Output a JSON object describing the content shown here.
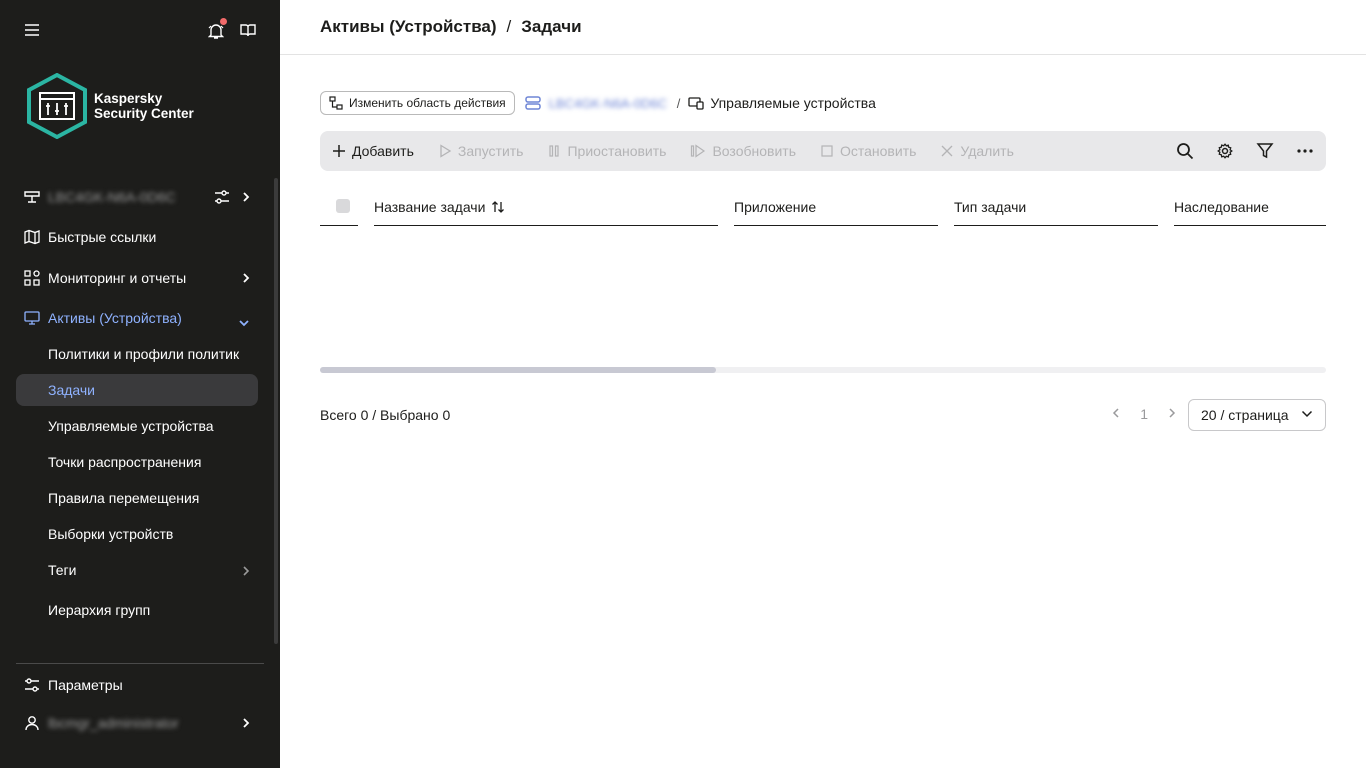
{
  "sidebar": {
    "logo_line1": "Kaspersky",
    "logo_line2": "Security Center",
    "server_name": "LBC4GK-N6A-0D6C",
    "quick_links": "Быстрые ссылки",
    "monitoring": "Мониторинг и отчеты",
    "assets": "Активы (Устройства)",
    "sub_items": [
      "Политики и профили политик",
      "Задачи",
      "Управляемые устройства",
      "Точки распространения",
      "Правила перемещения",
      "Выборки устройств",
      "Теги",
      "Иерархия групп"
    ],
    "settings": "Параметры",
    "user": "lbcmgr_administrator"
  },
  "header": {
    "crumb1": "Активы (Устройства)",
    "sep": "/",
    "crumb2": "Задачи"
  },
  "scope": {
    "change_button": "Изменить область действия",
    "server": "LBC4GK-N6A-0D6C",
    "sep": "/",
    "group": "Управляемые устройства"
  },
  "toolbar": {
    "add": "Добавить",
    "start": "Запустить",
    "pause": "Приостановить",
    "resume": "Возобновить",
    "stop": "Остановить",
    "delete": "Удалить"
  },
  "table": {
    "columns": [
      "Название задачи",
      "Приложение",
      "Тип задачи",
      "Наследование"
    ]
  },
  "footer": {
    "total": "Всего 0 / Выбрано 0",
    "page": "1",
    "page_size": "20 / страница"
  },
  "colors": {
    "sidebar_bg": "#1d1d1b",
    "accent": "#8fb2ff",
    "logo_teal": "#2bb5a3"
  }
}
